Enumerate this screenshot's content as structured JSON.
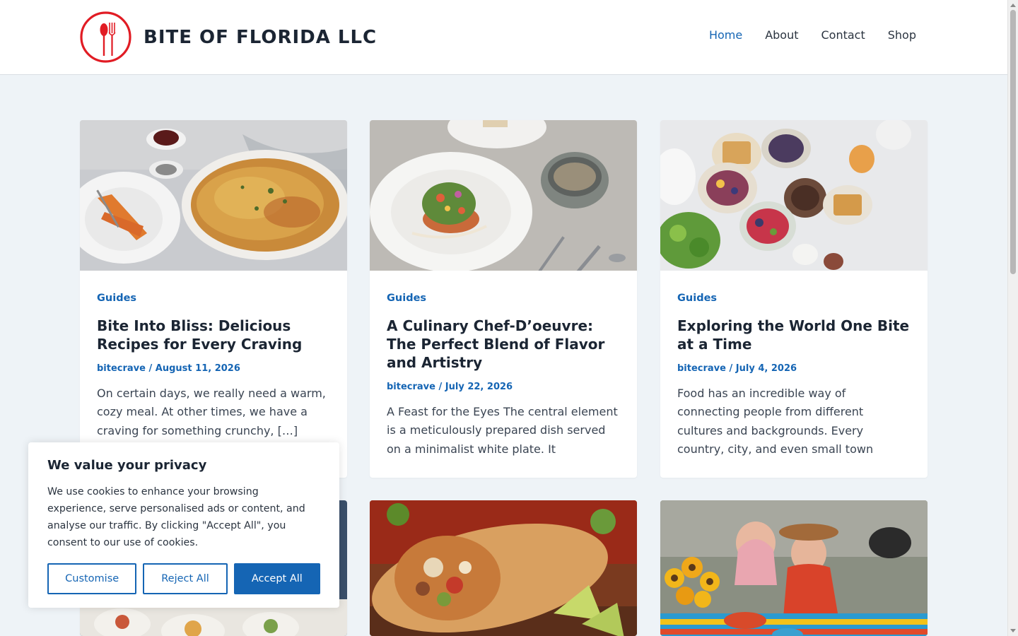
{
  "header": {
    "site_title": "BITE OF FLORIDA LLC",
    "nav": [
      {
        "label": "Home",
        "active": true
      },
      {
        "label": "About",
        "active": false
      },
      {
        "label": "Contact",
        "active": false
      },
      {
        "label": "Shop",
        "active": false
      }
    ]
  },
  "posts": [
    {
      "category": "Guides",
      "title": "Bite Into Bliss: Delicious Recipes for Every Craving",
      "author": "bitecrave",
      "date": "August 11, 2026",
      "excerpt": "On certain days, we really need a warm, cozy meal. At other times, we have a craving for something crunchy, […]",
      "image": "pasta-bake-photo"
    },
    {
      "category": "Guides",
      "title": "A Culinary Chef-D’oeuvre: The Perfect Blend of Flavor and Artistry",
      "author": "bitecrave",
      "date": "July 22, 2026",
      "excerpt": "A Feast for the Eyes The central element is a meticulously prepared dish served on a minimalist white plate. It",
      "image": "plated-salad-photo"
    },
    {
      "category": "Guides",
      "title": "Exploring the World One Bite at a Time",
      "author": "bitecrave",
      "date": "July 4, 2026",
      "excerpt": "Food has an incredible way of connecting people from different cultures and backgrounds. Every country, city, and even small town",
      "image": "breakfast-spread-photo"
    },
    {
      "image": "table-spread-photo"
    },
    {
      "image": "burrito-photo"
    },
    {
      "image": "sunflower-dinner-photo"
    }
  ],
  "cookie": {
    "title": "We value your privacy",
    "text": "We use cookies to enhance your browsing experience, serve personalised ads or content, and analyse our traffic. By clicking \"Accept All\", you consent to our use of cookies.",
    "customise": "Customise",
    "reject": "Reject All",
    "accept": "Accept All"
  },
  "colors": {
    "accent": "#1565b4",
    "logo_red": "#e11c24",
    "page_bg": "#eef3f7"
  }
}
